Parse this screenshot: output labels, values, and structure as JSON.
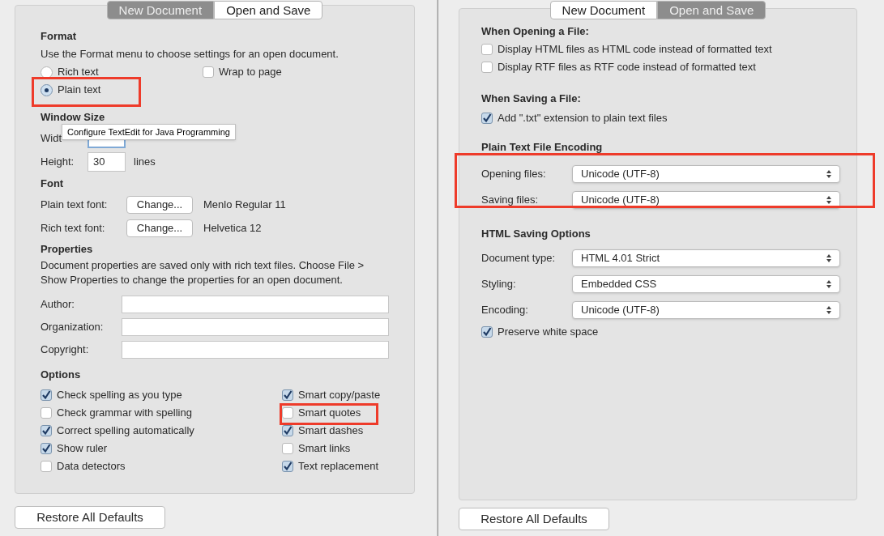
{
  "left": {
    "tabs": [
      {
        "label": "New Document",
        "selected": true
      },
      {
        "label": "Open and Save",
        "selected": false
      }
    ],
    "format": {
      "heading": "Format",
      "description": "Use the Format menu to choose settings for an open document.",
      "formats": [
        {
          "label": "Rich text",
          "selected": false,
          "highlighted": false
        },
        {
          "label": "Plain text",
          "selected": true,
          "highlighted": true
        }
      ],
      "wrap": {
        "label": "Wrap to page",
        "checked": false
      }
    },
    "window_size": {
      "heading": "Window Size",
      "rows": [
        {
          "label": "Widt"
        },
        {
          "label": "Height:",
          "value": "30",
          "unit": "lines"
        }
      ]
    },
    "tooltip": "Configure TextEdit for Java Programming",
    "font": {
      "heading": "Font",
      "rows": [
        {
          "label": "Plain text font:",
          "button": "Change...",
          "value": "Menlo Regular 11"
        },
        {
          "label": "Rich text font:",
          "button": "Change...",
          "value": "Helvetica 12"
        }
      ]
    },
    "properties": {
      "heading": "Properties",
      "description": "Document properties are saved only with rich text files. Choose File > Show Properties to change the properties for an open document.",
      "fields": [
        {
          "label": "Author:"
        },
        {
          "label": "Organization:"
        },
        {
          "label": "Copyright:"
        }
      ]
    },
    "options": {
      "heading": "Options",
      "columns": [
        [
          {
            "label": "Check spelling as you type",
            "checked": true,
            "highlighted": false
          },
          {
            "label": "Check grammar with spelling",
            "checked": false,
            "highlighted": false
          },
          {
            "label": "Correct spelling automatically",
            "checked": true,
            "highlighted": false
          },
          {
            "label": "Show ruler",
            "checked": true,
            "highlighted": false
          },
          {
            "label": "Data detectors",
            "checked": false,
            "highlighted": false
          }
        ],
        [
          {
            "label": "Smart copy/paste",
            "checked": true,
            "highlighted": false
          },
          {
            "label": "Smart quotes",
            "checked": false,
            "highlighted": true
          },
          {
            "label": "Smart dashes",
            "checked": true,
            "highlighted": false
          },
          {
            "label": "Smart links",
            "checked": false,
            "highlighted": false
          },
          {
            "label": "Text replacement",
            "checked": true,
            "highlighted": false
          }
        ]
      ]
    },
    "restore_button": "Restore All Defaults"
  },
  "right": {
    "tabs": [
      {
        "label": "New Document",
        "selected": false
      },
      {
        "label": "Open and Save",
        "selected": true
      }
    ],
    "opening": {
      "heading": "When Opening a File:",
      "items": [
        {
          "label": "Display HTML files as HTML code instead of formatted text",
          "checked": false
        },
        {
          "label": "Display RTF files as RTF code instead of formatted text",
          "checked": false
        }
      ]
    },
    "saving": {
      "heading": "When Saving a File:",
      "items": [
        {
          "label": "Add \".txt\" extension to plain text files",
          "checked": true
        }
      ]
    },
    "encoding": {
      "heading": "Plain Text File Encoding",
      "highlighted": true,
      "rows": [
        {
          "label": "Opening files:",
          "value": "Unicode (UTF-8)"
        },
        {
          "label": "Saving files:",
          "value": "Unicode (UTF-8)"
        }
      ]
    },
    "html": {
      "heading": "HTML Saving Options",
      "rows": [
        {
          "label": "Document type:",
          "value": "HTML 4.01 Strict"
        },
        {
          "label": "Styling:",
          "value": "Embedded CSS"
        },
        {
          "label": "Encoding:",
          "value": "Unicode (UTF-8)"
        }
      ],
      "items": [
        {
          "label": "Preserve white space",
          "checked": true
        }
      ]
    },
    "restore_button": "Restore All Defaults"
  }
}
